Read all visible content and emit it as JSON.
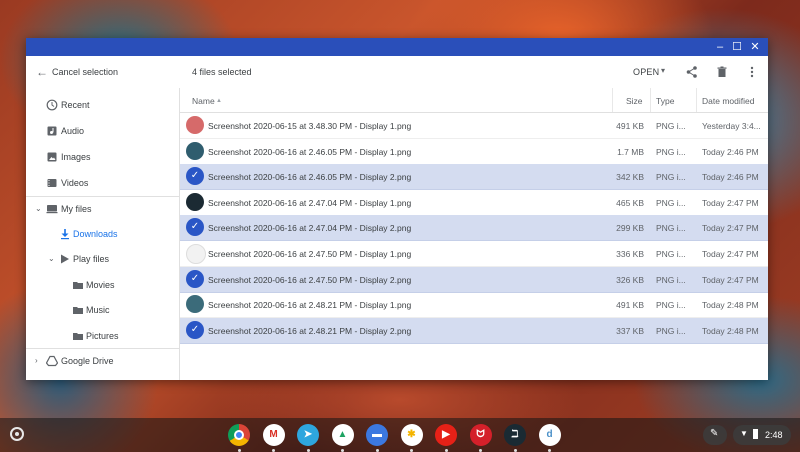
{
  "toolbar": {
    "cancel_selection": "Cancel selection",
    "selection_count": "4 files selected",
    "open_label": "OPEN"
  },
  "sidebar": {
    "recent": "Recent",
    "audio": "Audio",
    "images": "Images",
    "videos": "Videos",
    "my_files": "My files",
    "downloads": "Downloads",
    "play_files": "Play files",
    "movies": "Movies",
    "music": "Music",
    "pictures": "Pictures",
    "google_drive": "Google Drive"
  },
  "list": {
    "headers": {
      "name": "Name",
      "sort_indicator": "▲",
      "size": "Size",
      "type": "Type",
      "date_modified": "Date modified"
    },
    "rows": [
      {
        "name": "Screenshot 2020-06-15 at 3.48.30 PM - Display 1.png",
        "size": "491 KB",
        "type": "PNG i...",
        "date": "Yesterday 3:4...",
        "selected": false,
        "thumb": "#d66a6a"
      },
      {
        "name": "Screenshot 2020-06-16 at 2.46.05 PM - Display 1.png",
        "size": "1.7 MB",
        "type": "PNG i...",
        "date": "Today 2:46 PM",
        "selected": false,
        "thumb": "#2f5d6e"
      },
      {
        "name": "Screenshot 2020-06-16 at 2.46.05 PM - Display 2.png",
        "size": "342 KB",
        "type": "PNG i...",
        "date": "Today 2:46 PM",
        "selected": true,
        "thumb": "#2a56c6"
      },
      {
        "name": "Screenshot 2020-06-16 at 2.47.04 PM - Display 1.png",
        "size": "465 KB",
        "type": "PNG i...",
        "date": "Today 2:47 PM",
        "selected": false,
        "thumb": "#1b2a33"
      },
      {
        "name": "Screenshot 2020-06-16 at 2.47.04 PM - Display 2.png",
        "size": "299 KB",
        "type": "PNG i...",
        "date": "Today 2:47 PM",
        "selected": true,
        "thumb": "#2a56c6"
      },
      {
        "name": "Screenshot 2020-06-16 at 2.47.50 PM - Display 1.png",
        "size": "336 KB",
        "type": "PNG i...",
        "date": "Today 2:47 PM",
        "selected": false,
        "thumb": "#f2f2f2"
      },
      {
        "name": "Screenshot 2020-06-16 at 2.47.50 PM - Display 2.png",
        "size": "326 KB",
        "type": "PNG i...",
        "date": "Today 2:47 PM",
        "selected": true,
        "thumb": "#2a56c6"
      },
      {
        "name": "Screenshot 2020-06-16 at 2.48.21 PM - Display 1.png",
        "size": "491 KB",
        "type": "PNG i...",
        "date": "Today 2:48 PM",
        "selected": false,
        "thumb": "#3b6b7a"
      },
      {
        "name": "Screenshot 2020-06-16 at 2.48.21 PM - Display 2.png",
        "size": "337 KB",
        "type": "PNG i...",
        "date": "Today 2:48 PM",
        "selected": true,
        "thumb": "#2a56c6"
      }
    ]
  },
  "shelf": {
    "apps": [
      {
        "name": "chrome-icon",
        "color": "#e0402e",
        "glyph": ""
      },
      {
        "name": "gmail-icon",
        "color": "#ffffff",
        "glyph": "M"
      },
      {
        "name": "telegram-icon",
        "color": "#2ea6de",
        "glyph": "➤"
      },
      {
        "name": "google-drive-icon",
        "color": "#ffffff",
        "glyph": "▲"
      },
      {
        "name": "files-icon",
        "color": "#3c78e0",
        "glyph": "▬"
      },
      {
        "name": "google-photos-icon",
        "color": "#ffffff",
        "glyph": "✱"
      },
      {
        "name": "youtube-icon",
        "color": "#e62117",
        "glyph": "▶"
      },
      {
        "name": "acrobat-icon",
        "color": "#d4202a",
        "glyph": "ᗢ"
      },
      {
        "name": "dashlane-icon",
        "color": "#1a2a33",
        "glyph": "ℶ"
      },
      {
        "name": "dict-icon",
        "color": "#ffffff",
        "glyph": "d"
      }
    ],
    "time": "2:48"
  }
}
